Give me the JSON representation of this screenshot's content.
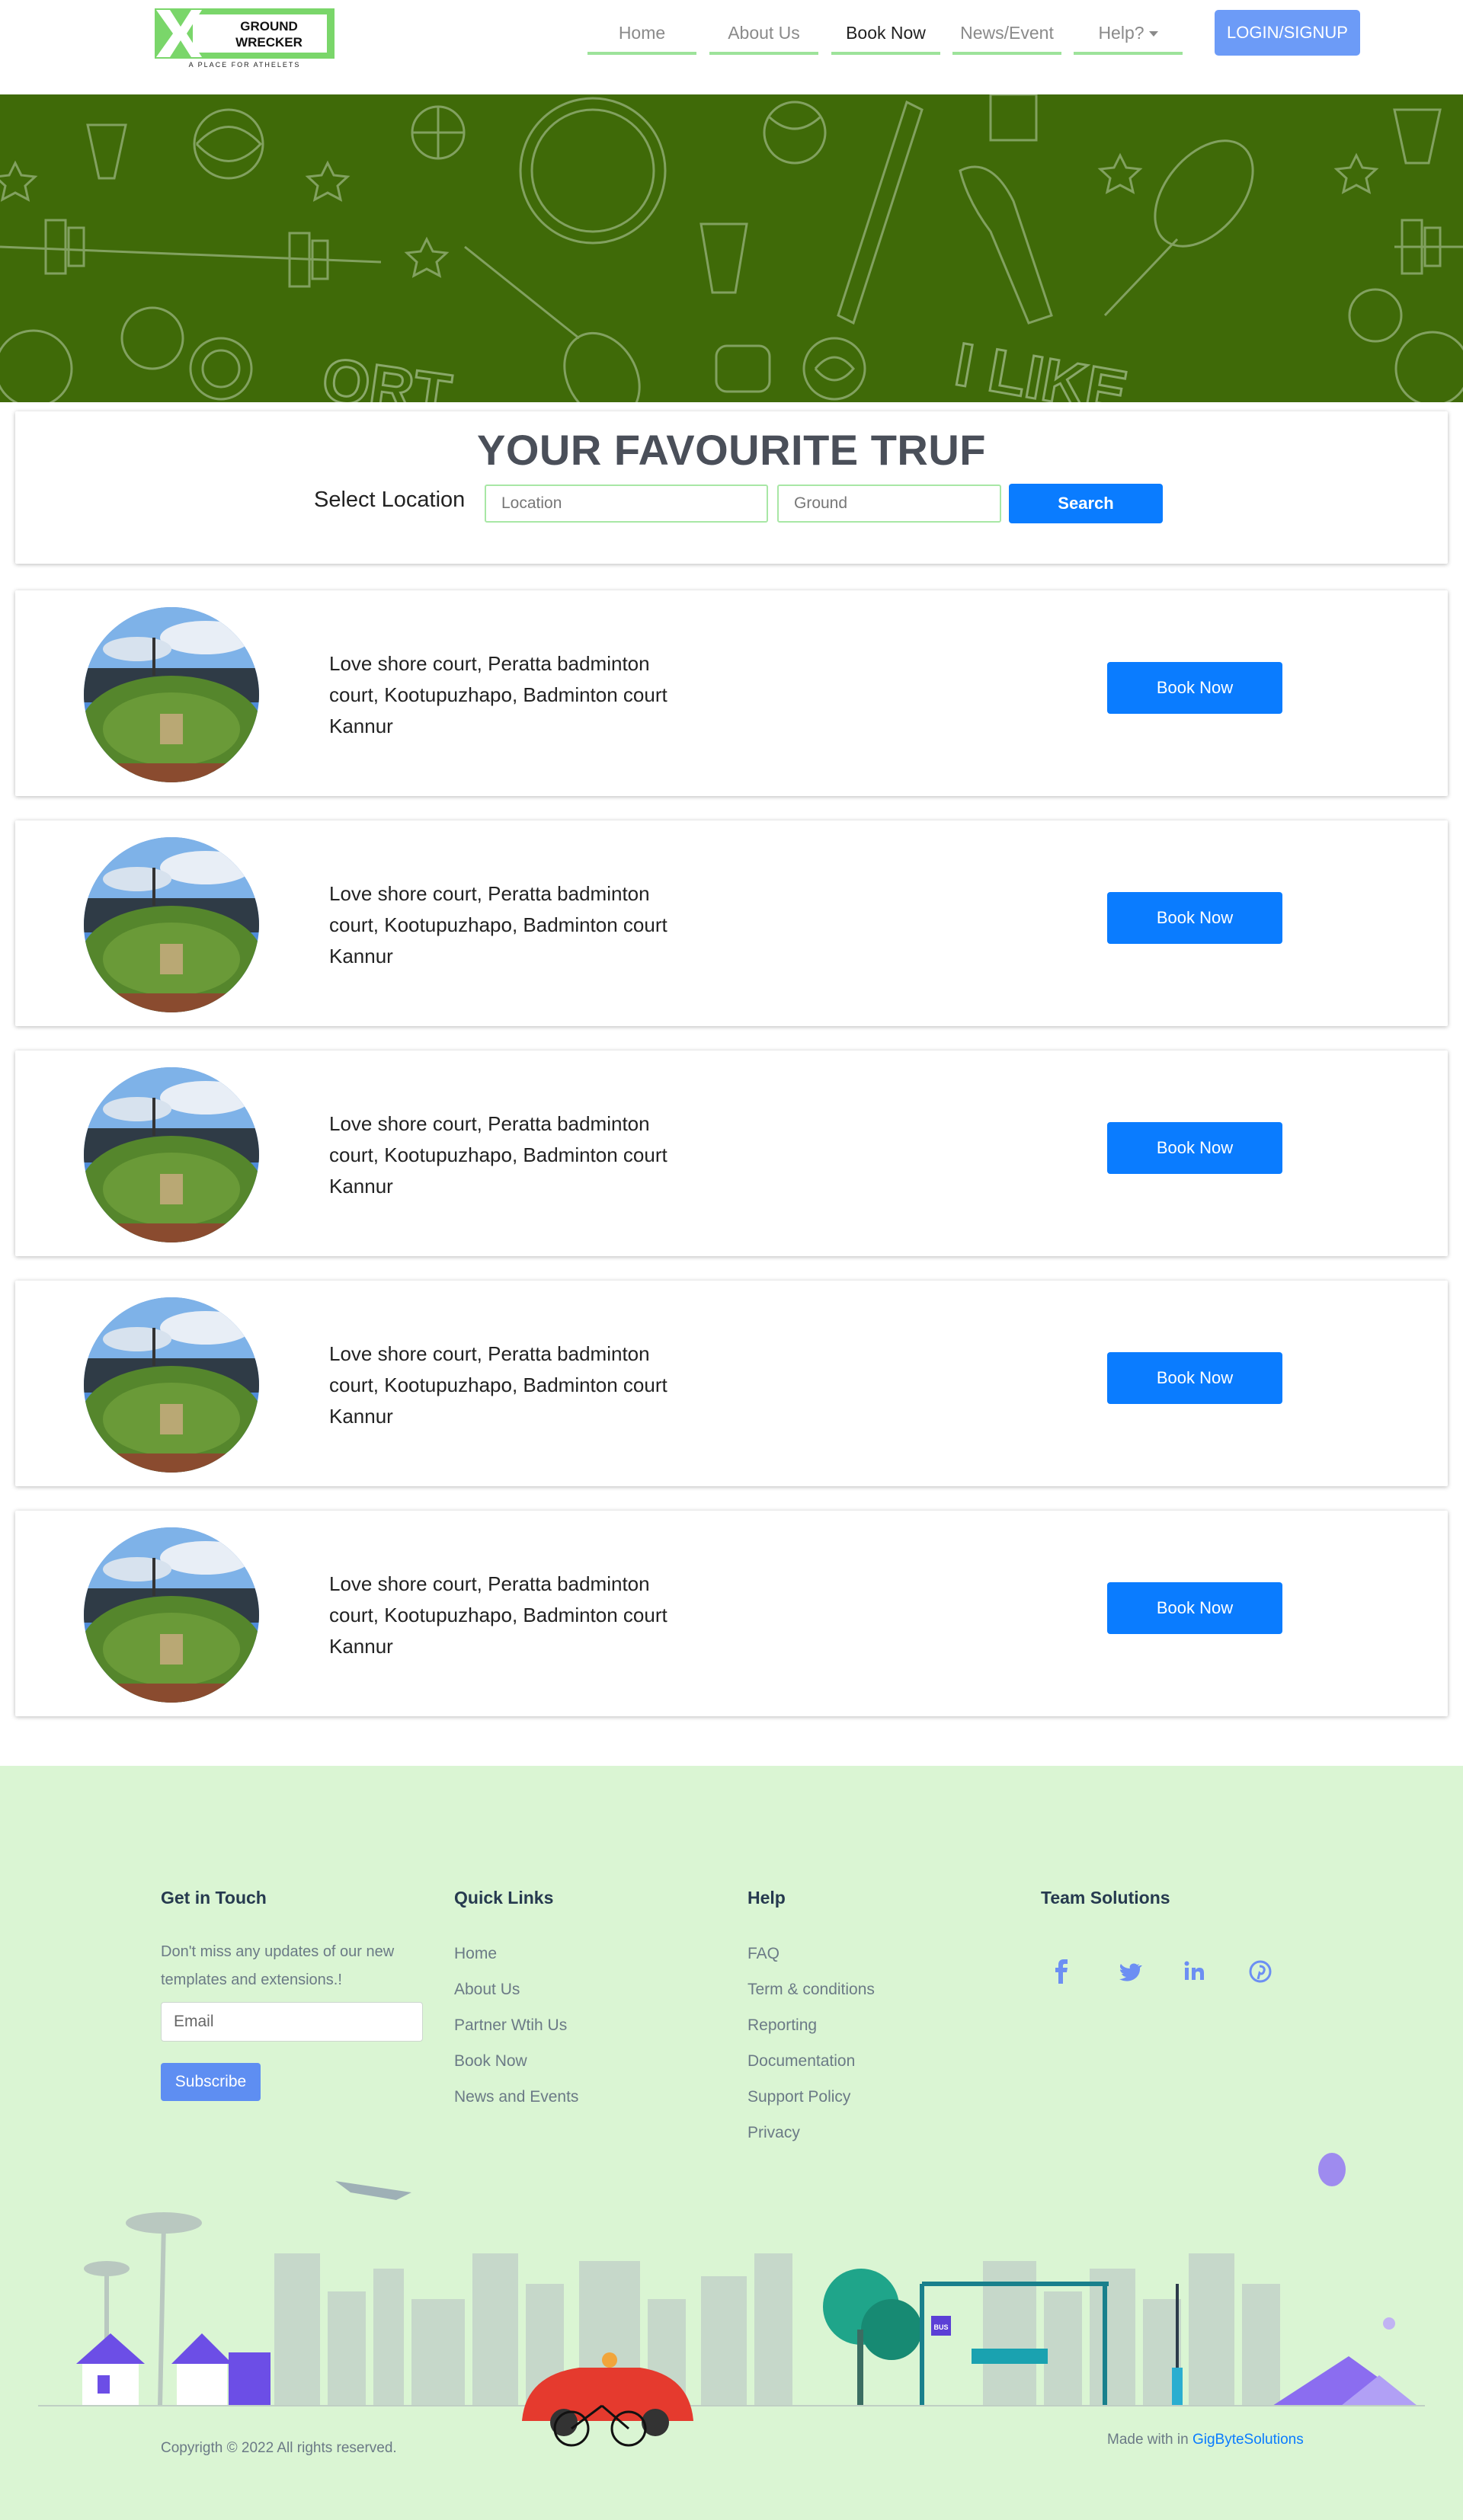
{
  "brand": {
    "logo_line1": "GROUND",
    "logo_line2": "WRECKER",
    "tagline": "A PLACE FOR ATHELETS"
  },
  "nav": {
    "items": [
      {
        "label": "Home"
      },
      {
        "label": "About Us"
      },
      {
        "label": "Book Now"
      },
      {
        "label": "News/Event"
      },
      {
        "label": "Help?"
      }
    ],
    "login_label": "LOGIN/SIGNUP"
  },
  "banner": {
    "text_1": "I LIKE",
    "text_2": "ORT"
  },
  "search": {
    "title": "YOUR FAVOURITE TRUF",
    "select_label": "Select Location",
    "location_placeholder": "Location",
    "ground_placeholder": "Ground",
    "button_label": "Search"
  },
  "results": [
    {
      "text": "Love shore court, Peratta badminton court, Kootupuzhapo, Badminton court Kannur",
      "button": "Book Now"
    },
    {
      "text": "Love shore court, Peratta badminton court, Kootupuzhapo, Badminton court Kannur",
      "button": "Book Now"
    },
    {
      "text": "Love shore court, Peratta badminton court, Kootupuzhapo, Badminton court Kannur",
      "button": "Book Now"
    },
    {
      "text": "Love shore court, Peratta badminton court, Kootupuzhapo, Badminton court Kannur",
      "button": "Book Now"
    },
    {
      "text": "Love shore court, Peratta badminton court, Kootupuzhapo, Badminton court Kannur",
      "button": "Book Now"
    }
  ],
  "footer": {
    "get_in_touch": {
      "heading": "Get in Touch",
      "text": "Don't miss any updates of our new templates and extensions.!",
      "email_placeholder": "Email",
      "subscribe_label": "Subscribe"
    },
    "quick_links": {
      "heading": "Quick Links",
      "items": [
        "Home",
        "About Us",
        "Partner Wtih Us",
        "Book Now",
        "News and Events"
      ]
    },
    "help": {
      "heading": "Help",
      "items": [
        "FAQ",
        "Term & conditions",
        "Reporting",
        "Documentation",
        "Support Policy",
        "Privacy"
      ]
    },
    "team": {
      "heading": "Team Solutions",
      "socials": [
        "facebook-icon",
        "twitter-icon",
        "linkedin-icon",
        "pinterest-icon"
      ]
    },
    "copyright": "Copyrigth © 2022 All rights reserved.",
    "made_with_prefix": "Made with in ",
    "made_with_brand": "GigByteSolutions",
    "bus_stop_sign": "BUS"
  },
  "colors": {
    "banner": "#3f6a08",
    "primary": "#0a7cff",
    "login": "#6c9bf7",
    "footer_bg": "#daf5d3",
    "nav_underline": "#9de39a"
  }
}
